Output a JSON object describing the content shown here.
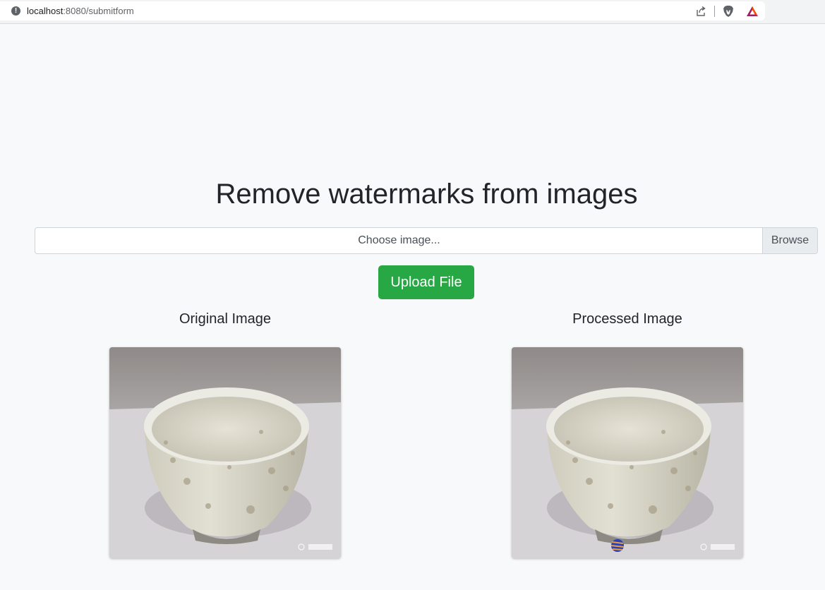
{
  "browser": {
    "url_host": "localhost",
    "url_path": ":8080/submitform",
    "icons": [
      "info-icon",
      "share-icon",
      "brave-lion-icon",
      "bat-triangle-icon"
    ]
  },
  "page": {
    "title": "Remove watermarks from images",
    "file_input_label": "Choose image...",
    "browse_label": "Browse",
    "upload_label": "Upload File",
    "original_heading": "Original Image",
    "processed_heading": "Processed Image"
  },
  "colors": {
    "accent_green": "#28a745",
    "background": "#f8f9fa",
    "text": "#212529"
  }
}
